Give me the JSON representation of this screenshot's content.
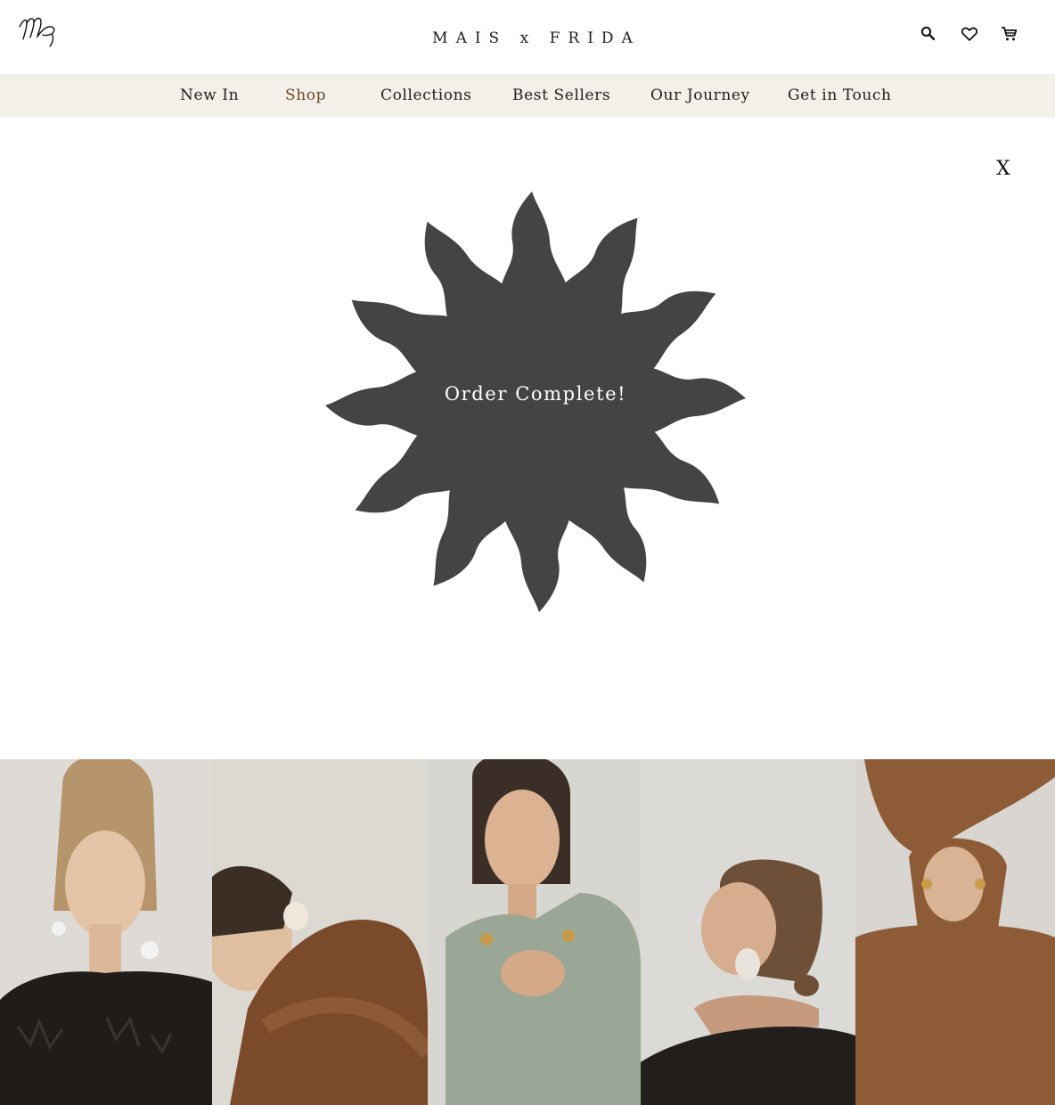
{
  "header": {
    "brand": "MAIS x FRIDA",
    "logo_icon": "monogram-logo-icon",
    "icons": [
      "search-icon",
      "heart-icon",
      "cart-icon"
    ]
  },
  "nav": {
    "items": [
      {
        "label": "New In"
      },
      {
        "label": "Shop"
      },
      {
        "label": "Collections"
      },
      {
        "label": "Best Sellers"
      },
      {
        "label": "Our Journey"
      },
      {
        "label": "Get in Touch"
      }
    ],
    "active": "Shop",
    "active_color": "#6b4a27",
    "background": "#f3efe9"
  },
  "modal": {
    "close_label": "X",
    "message": "Order Complete!",
    "sun_color": "#444444",
    "sun_icon": "sun-badge-icon"
  },
  "gallery": {
    "panels": [
      {
        "name": "model-lace-top-photo"
      },
      {
        "name": "model-knit-dress-crouching-photo"
      },
      {
        "name": "model-sage-asymmetric-dress-photo"
      },
      {
        "name": "model-profile-lace-photo"
      },
      {
        "name": "model-knit-arms-raised-photo"
      }
    ]
  }
}
